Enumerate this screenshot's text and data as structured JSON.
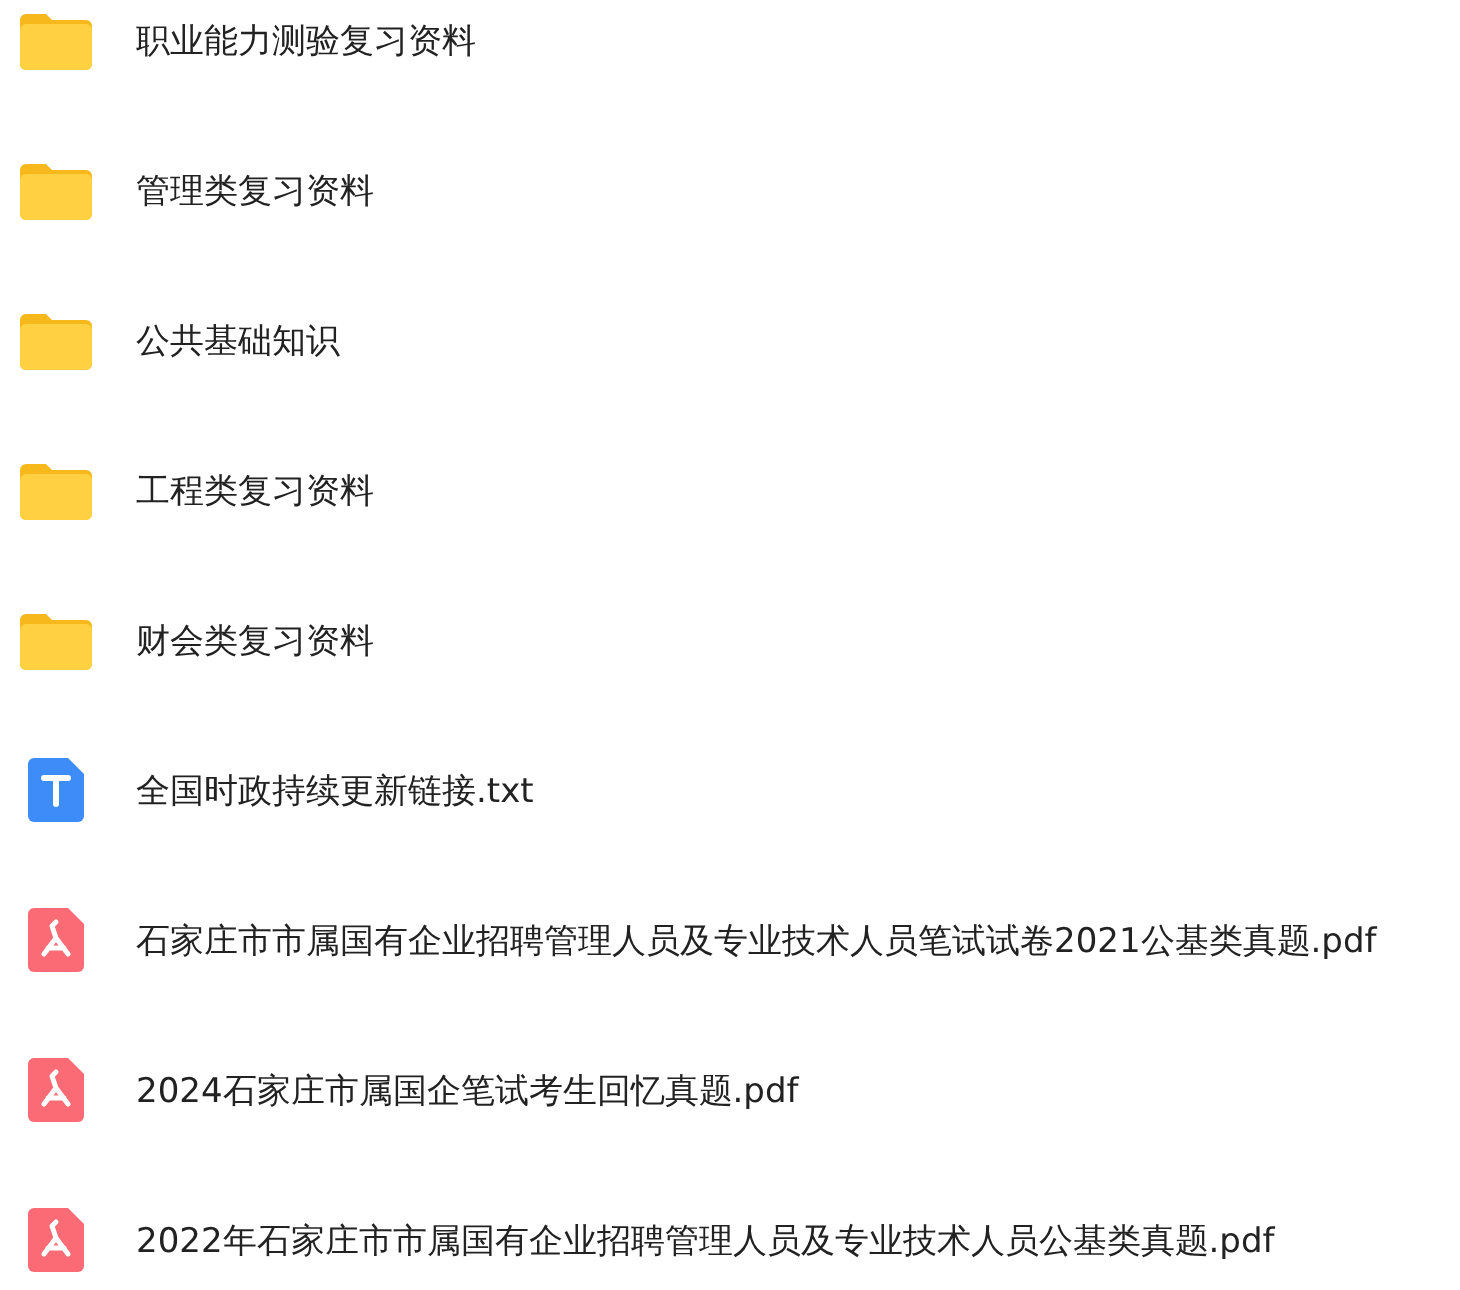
{
  "files": [
    {
      "kind": "folder",
      "name": "职业能力测验复习资料"
    },
    {
      "kind": "folder",
      "name": "管理类复习资料"
    },
    {
      "kind": "folder",
      "name": "公共基础知识"
    },
    {
      "kind": "folder",
      "name": "工程类复习资料"
    },
    {
      "kind": "folder",
      "name": "财会类复习资料"
    },
    {
      "kind": "txt",
      "name": "全国时政持续更新链接.txt"
    },
    {
      "kind": "pdf",
      "name": "石家庄市市属国有企业招聘管理人员及专业技术人员笔试试卷2021公基类真题.pdf"
    },
    {
      "kind": "pdf",
      "name": "2024石家庄市属国企笔试考生回忆真题.pdf"
    },
    {
      "kind": "pdf",
      "name": "2022年石家庄市市属国有企业招聘管理人员及专业技术人员公基类真题.pdf"
    }
  ]
}
